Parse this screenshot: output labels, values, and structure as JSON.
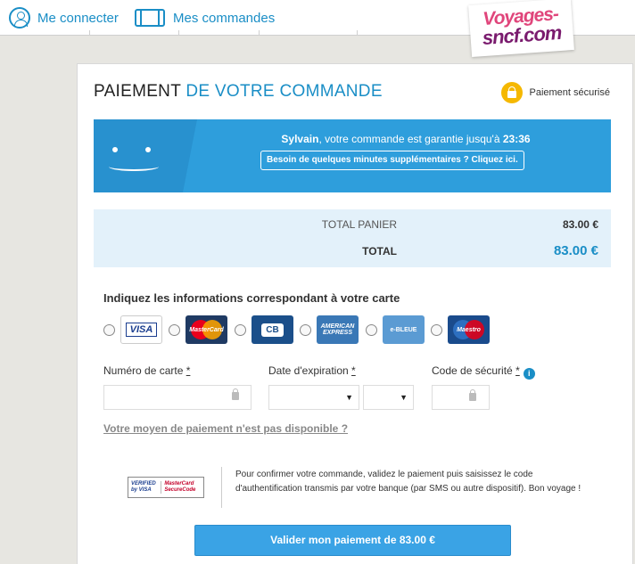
{
  "topbar": {
    "login_label": "Me connecter",
    "orders_label": "Mes commandes",
    "logo_line1": "Voyages-",
    "logo_line2": "sncf.com"
  },
  "header": {
    "title_part1": "PAIEMENT ",
    "title_part2": "DE VOTRE COMMANDE",
    "secure_label": "Paiement sécurisé"
  },
  "timer": {
    "name": "Sylvain",
    "message_before_time": ", votre commande est garantie jusqu'à ",
    "time": "23:36",
    "extend_label": "Besoin de quelques minutes supplémentaires ? Cliquez ici."
  },
  "totals": {
    "cart_label": "TOTAL PANIER",
    "cart_value": "83.00 €",
    "total_label": "TOTAL",
    "total_value": "83.00 €"
  },
  "card_form": {
    "heading": "Indiquez les informations correspondant à votre carte",
    "brands": [
      {
        "name": "VISA",
        "selected": true
      },
      {
        "name": "MasterCard",
        "selected": false
      },
      {
        "name": "CB",
        "selected": false
      },
      {
        "name": "AMERICAN EXPRESS",
        "selected": false
      },
      {
        "name": "e-BLEUE",
        "selected": false
      },
      {
        "name": "Maestro",
        "selected": false
      }
    ],
    "card_number_label": "Numéro de carte",
    "expiry_label": "Date d'expiration",
    "cvv_label": "Code de sécurité",
    "required_mark": "*",
    "card_number_value": "",
    "expiry_month_value": "",
    "expiry_year_value": "",
    "cvv_value": "",
    "unavailable_link": "Votre moyen de paiement n'est pas disponible ?"
  },
  "secure_code": {
    "verified_label": "VERIFIED by VISA",
    "mc_label": "MasterCard SecureCode",
    "text": "Pour confirmer votre commande, validez le paiement puis saisissez le code d'authentification transmis par votre banque (par SMS ou autre dispositif). Bon voyage !"
  },
  "actions": {
    "pay_label": "Valider mon paiement de 83.00 €"
  },
  "colors": {
    "accent": "#1a8ec6",
    "button": "#3aa3e5",
    "lock": "#f5b800"
  }
}
